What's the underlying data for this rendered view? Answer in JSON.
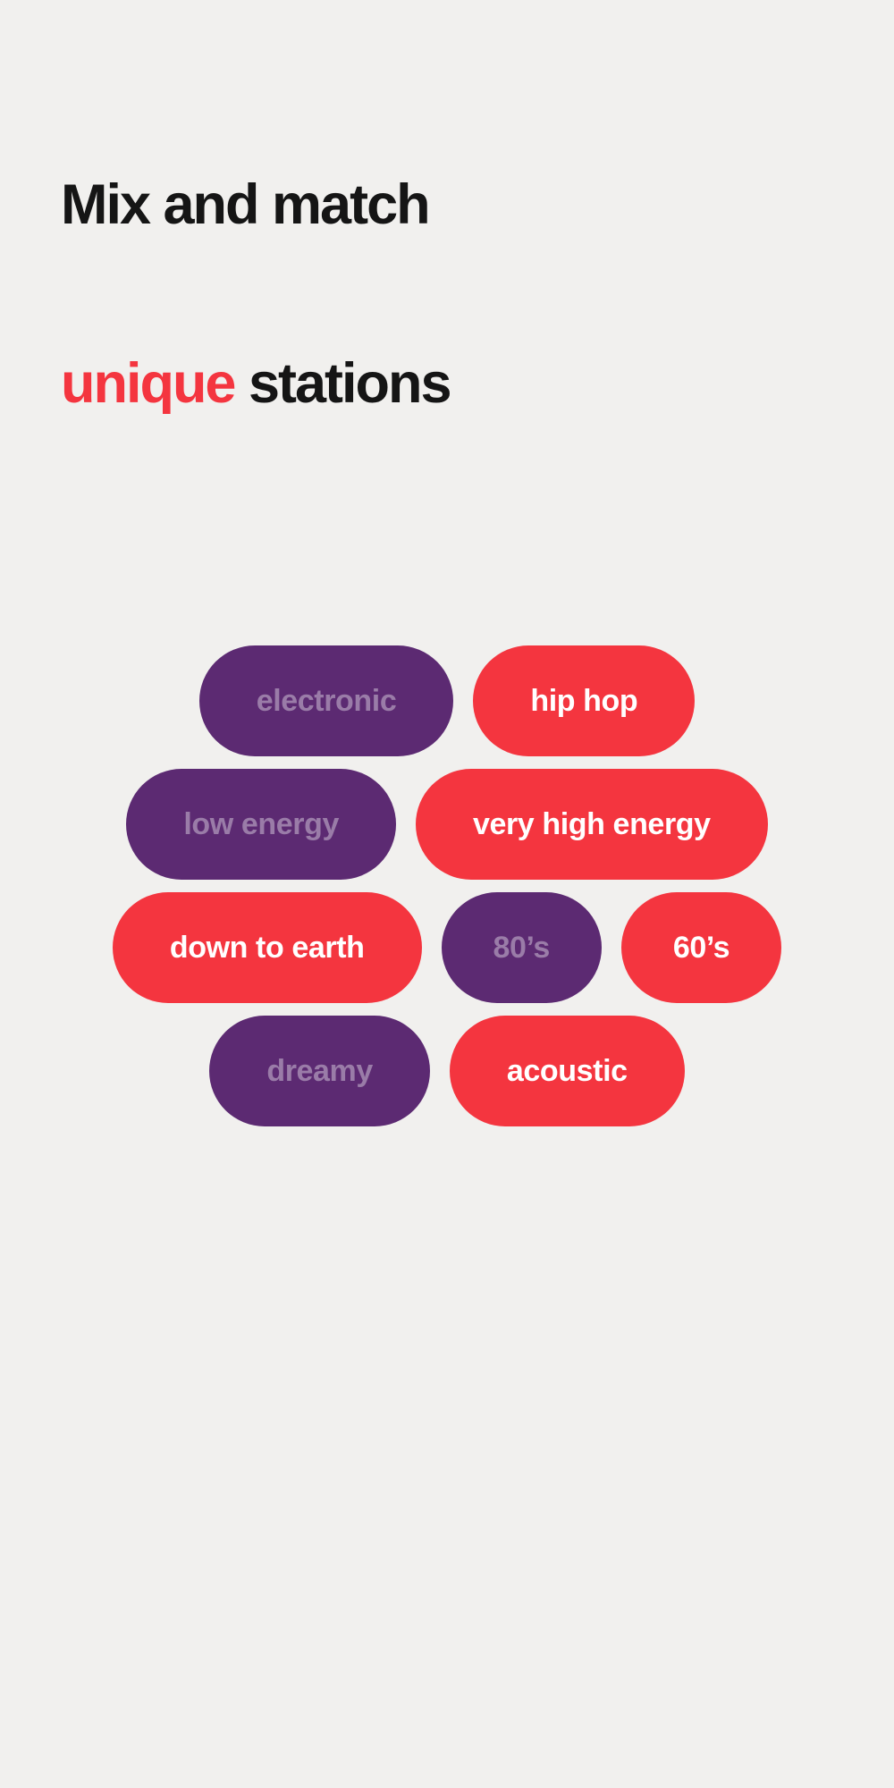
{
  "theme": {
    "background": "#F1F0EE",
    "accent_red": "#F4353F",
    "chip_purple": "#5C2A72",
    "chip_selected_text": "#FFFFFF",
    "chip_unselected_text": "#9A7CA8",
    "heading_text": "#151515"
  },
  "heading": {
    "line1": "Mix and match",
    "line2_accent": "unique",
    "line2_rest": " stations"
  },
  "chips": {
    "rows": [
      {
        "items": [
          {
            "label": "electronic",
            "state": "unselected",
            "color": "#5C2A72"
          },
          {
            "label": "hip hop",
            "state": "selected",
            "color": "#F4353F"
          }
        ]
      },
      {
        "items": [
          {
            "label": "low energy",
            "state": "unselected",
            "color": "#5C2A72"
          },
          {
            "label": "very high energy",
            "state": "selected",
            "color": "#F4353F"
          }
        ]
      },
      {
        "items": [
          {
            "label": "down to earth",
            "state": "selected",
            "color": "#F4353F"
          },
          {
            "label": "80’s",
            "state": "unselected",
            "color": "#5C2A72"
          },
          {
            "label": "60’s",
            "state": "selected",
            "color": "#F4353F"
          }
        ]
      },
      {
        "items": [
          {
            "label": "dreamy",
            "state": "unselected",
            "color": "#5C2A72"
          },
          {
            "label": "acoustic",
            "state": "selected",
            "color": "#F4353F"
          }
        ]
      }
    ]
  }
}
